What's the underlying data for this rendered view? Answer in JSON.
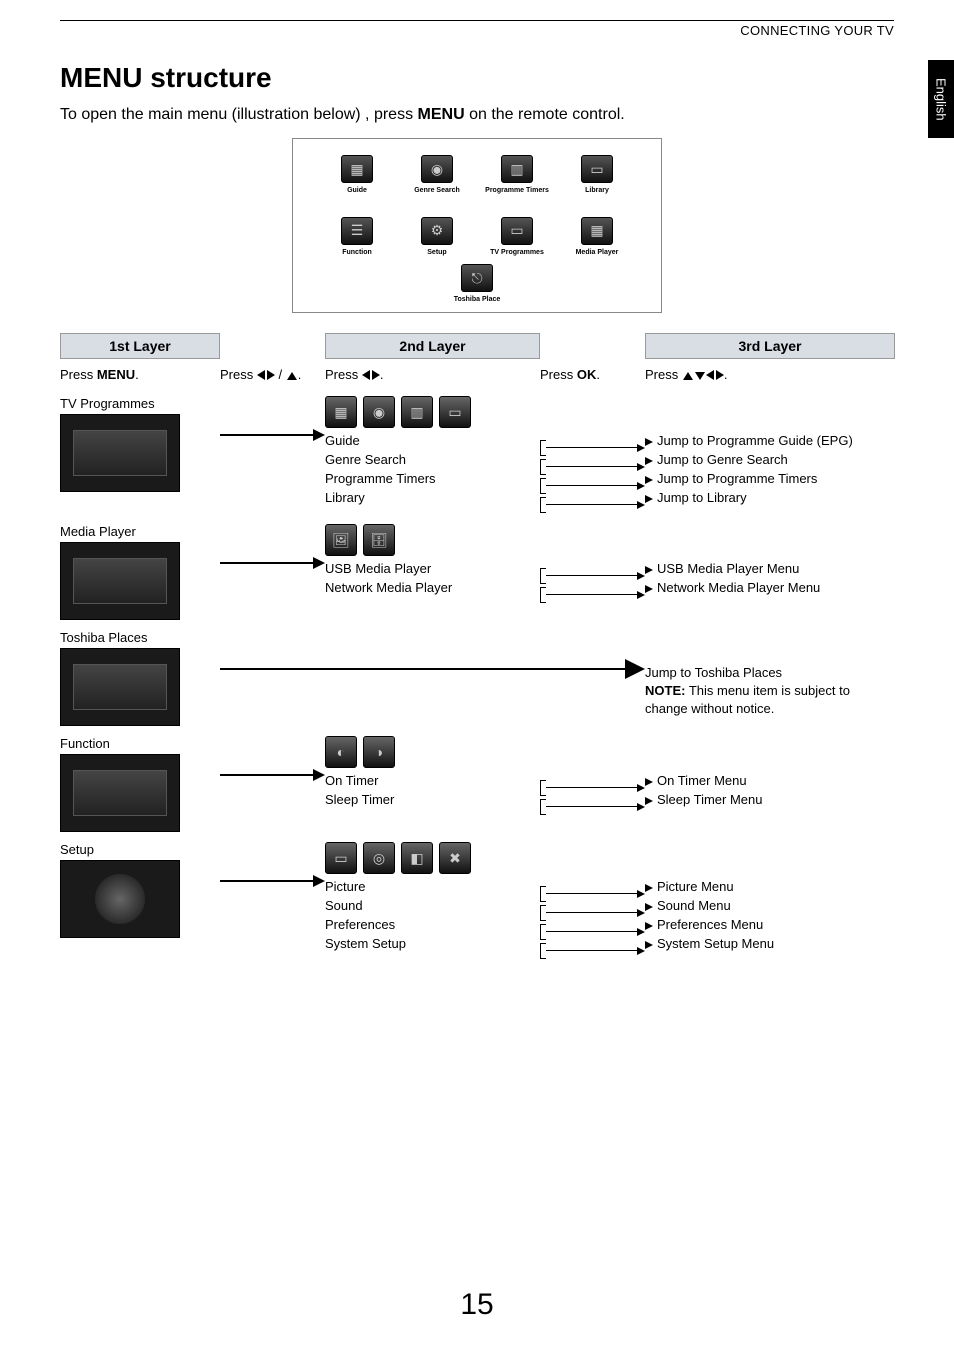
{
  "header": {
    "section": "CONNECTING YOUR TV",
    "language_tab": "English"
  },
  "title": "MENU structure",
  "intro": {
    "prefix": "To open the main menu (illustration below) , press ",
    "bold": "MENU",
    "suffix": " on the remote control."
  },
  "main_menu": {
    "items": [
      {
        "label": "Guide",
        "glyph": "▦"
      },
      {
        "label": "Genre Search",
        "glyph": "◉"
      },
      {
        "label": "Programme Timers",
        "glyph": "▥"
      },
      {
        "label": "Library",
        "glyph": "▭"
      },
      {
        "label": "Function",
        "glyph": "☰"
      },
      {
        "label": "Setup",
        "glyph": "⚙"
      },
      {
        "label": "TV Programmes",
        "glyph": "▭"
      },
      {
        "label": "Media Player",
        "glyph": "▦"
      },
      {
        "label": "Toshiba Place",
        "glyph": "⎋"
      }
    ]
  },
  "layers": {
    "headers": [
      "1st Layer",
      "2nd Layer",
      "3rd Layer"
    ],
    "instr": {
      "layer1": {
        "prefix": "Press ",
        "bold": "MENU",
        "suffix": "."
      },
      "arrow12_prefix": "Press ",
      "arrow12_suffix": ".",
      "layer2_prefix": "Press ",
      "layer2_suffix": ".",
      "arrow23": {
        "prefix": "Press ",
        "bold": "OK",
        "suffix": "."
      },
      "layer3_prefix": "Press ",
      "layer3_suffix": "."
    }
  },
  "sections": [
    {
      "name": "TV Programmes",
      "icons": [
        "▦",
        "◉",
        "▥",
        "▭"
      ],
      "layer2": [
        "Guide",
        "Genre Search",
        "Programme Timers",
        "Library"
      ],
      "layer3": [
        "Jump to Programme Guide (EPG)",
        "Jump to Genre Search",
        "Jump to Programme Timers",
        "Jump to Library"
      ]
    },
    {
      "name": "Media Player",
      "icons": [
        "🖼",
        "🗄"
      ],
      "layer2": [
        "USB Media Player",
        "Network Media Player"
      ],
      "layer3": [
        "USB Media Player Menu",
        "Network Media Player Menu"
      ]
    },
    {
      "name": "Toshiba Places",
      "type": "direct",
      "layer3_text": "Jump to Toshiba Places",
      "note": {
        "bold": "NOTE:",
        "text": " This menu item is subject to change without notice."
      }
    },
    {
      "name": "Function",
      "icons": [
        "◐",
        "◑"
      ],
      "layer2": [
        "On Timer",
        "Sleep Timer"
      ],
      "layer3": [
        "On Timer Menu",
        "Sleep Timer Menu"
      ]
    },
    {
      "name": "Setup",
      "icons": [
        "▭",
        "◎",
        "◧",
        "✖"
      ],
      "thumb_variant": "gear",
      "layer2": [
        "Picture",
        "Sound",
        "Preferences",
        "System Setup"
      ],
      "layer3": [
        "Picture Menu",
        "Sound Menu",
        "Preferences Menu",
        "System Setup Menu"
      ]
    }
  ],
  "page_number": "15"
}
